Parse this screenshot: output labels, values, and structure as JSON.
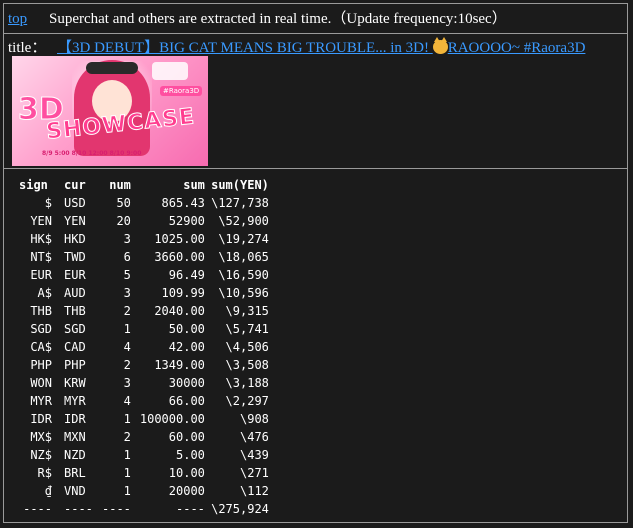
{
  "header": {
    "top_link": "top",
    "message": "Superchat and others are extracted in real time.（Update frequency:10sec）"
  },
  "video": {
    "title_label": "title：",
    "title_text": "【3D DEBUT】BIG CAT MEANS BIG TROUBLE... in 3D!",
    "title_suffix": "RAOOOO~ #Raora3D",
    "title_emoji": "cat-face-icon",
    "thumbnail": {
      "big_text": "3D",
      "showcase_text": "SHOWCASE",
      "tag": "#Raora3D",
      "dates": "8/9 5:00   8/10 12:00   8/10 9:00"
    }
  },
  "table": {
    "headers": {
      "sign": "sign",
      "cur": "cur",
      "num": "num",
      "sum": "sum",
      "yen": "sum(YEN)"
    },
    "rows": [
      {
        "sign": "$",
        "cur": "USD",
        "num": "50",
        "sum": "865.43",
        "yen": "\\127,738"
      },
      {
        "sign": "YEN",
        "cur": "YEN",
        "num": "20",
        "sum": "52900",
        "yen": "\\52,900"
      },
      {
        "sign": "HK$",
        "cur": "HKD",
        "num": "3",
        "sum": "1025.00",
        "yen": "\\19,274"
      },
      {
        "sign": "NT$",
        "cur": "TWD",
        "num": "6",
        "sum": "3660.00",
        "yen": "\\18,065"
      },
      {
        "sign": "EUR",
        "cur": "EUR",
        "num": "5",
        "sum": "96.49",
        "yen": "\\16,590"
      },
      {
        "sign": "A$",
        "cur": "AUD",
        "num": "3",
        "sum": "109.99",
        "yen": "\\10,596"
      },
      {
        "sign": "THB",
        "cur": "THB",
        "num": "2",
        "sum": "2040.00",
        "yen": "\\9,315"
      },
      {
        "sign": "SGD",
        "cur": "SGD",
        "num": "1",
        "sum": "50.00",
        "yen": "\\5,741"
      },
      {
        "sign": "CA$",
        "cur": "CAD",
        "num": "4",
        "sum": "42.00",
        "yen": "\\4,506"
      },
      {
        "sign": "PHP",
        "cur": "PHP",
        "num": "2",
        "sum": "1349.00",
        "yen": "\\3,508"
      },
      {
        "sign": "WON",
        "cur": "KRW",
        "num": "3",
        "sum": "30000",
        "yen": "\\3,188"
      },
      {
        "sign": "MYR",
        "cur": "MYR",
        "num": "4",
        "sum": "66.00",
        "yen": "\\2,297"
      },
      {
        "sign": "IDR",
        "cur": "IDR",
        "num": "1",
        "sum": "100000.00",
        "yen": "\\908"
      },
      {
        "sign": "MX$",
        "cur": "MXN",
        "num": "2",
        "sum": "60.00",
        "yen": "\\476"
      },
      {
        "sign": "NZ$",
        "cur": "NZD",
        "num": "1",
        "sum": "5.00",
        "yen": "\\439"
      },
      {
        "sign": "R$",
        "cur": "BRL",
        "num": "1",
        "sum": "10.00",
        "yen": "\\271"
      },
      {
        "sign": "₫",
        "cur": "VND",
        "num": "1",
        "sum": "20000",
        "yen": "\\112"
      }
    ],
    "total": {
      "sign": "----",
      "cur": "----",
      "num": "----",
      "sum": "----",
      "yen": "\\275,924"
    }
  }
}
